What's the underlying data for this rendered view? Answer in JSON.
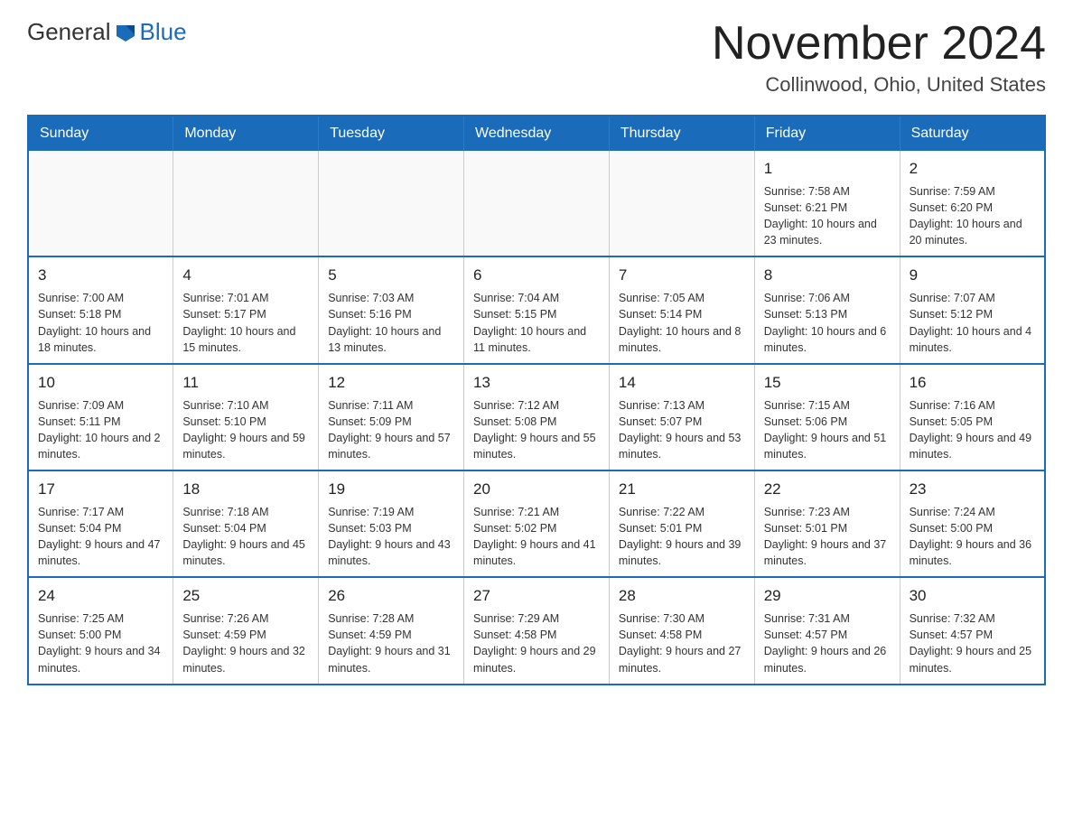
{
  "logo": {
    "general": "General",
    "blue": "Blue"
  },
  "title": "November 2024",
  "subtitle": "Collinwood, Ohio, United States",
  "weekdays": [
    "Sunday",
    "Monday",
    "Tuesday",
    "Wednesday",
    "Thursday",
    "Friday",
    "Saturday"
  ],
  "weeks": [
    [
      {
        "day": "",
        "info": ""
      },
      {
        "day": "",
        "info": ""
      },
      {
        "day": "",
        "info": ""
      },
      {
        "day": "",
        "info": ""
      },
      {
        "day": "",
        "info": ""
      },
      {
        "day": "1",
        "info": "Sunrise: 7:58 AM\nSunset: 6:21 PM\nDaylight: 10 hours and 23 minutes."
      },
      {
        "day": "2",
        "info": "Sunrise: 7:59 AM\nSunset: 6:20 PM\nDaylight: 10 hours and 20 minutes."
      }
    ],
    [
      {
        "day": "3",
        "info": "Sunrise: 7:00 AM\nSunset: 5:18 PM\nDaylight: 10 hours and 18 minutes."
      },
      {
        "day": "4",
        "info": "Sunrise: 7:01 AM\nSunset: 5:17 PM\nDaylight: 10 hours and 15 minutes."
      },
      {
        "day": "5",
        "info": "Sunrise: 7:03 AM\nSunset: 5:16 PM\nDaylight: 10 hours and 13 minutes."
      },
      {
        "day": "6",
        "info": "Sunrise: 7:04 AM\nSunset: 5:15 PM\nDaylight: 10 hours and 11 minutes."
      },
      {
        "day": "7",
        "info": "Sunrise: 7:05 AM\nSunset: 5:14 PM\nDaylight: 10 hours and 8 minutes."
      },
      {
        "day": "8",
        "info": "Sunrise: 7:06 AM\nSunset: 5:13 PM\nDaylight: 10 hours and 6 minutes."
      },
      {
        "day": "9",
        "info": "Sunrise: 7:07 AM\nSunset: 5:12 PM\nDaylight: 10 hours and 4 minutes."
      }
    ],
    [
      {
        "day": "10",
        "info": "Sunrise: 7:09 AM\nSunset: 5:11 PM\nDaylight: 10 hours and 2 minutes."
      },
      {
        "day": "11",
        "info": "Sunrise: 7:10 AM\nSunset: 5:10 PM\nDaylight: 9 hours and 59 minutes."
      },
      {
        "day": "12",
        "info": "Sunrise: 7:11 AM\nSunset: 5:09 PM\nDaylight: 9 hours and 57 minutes."
      },
      {
        "day": "13",
        "info": "Sunrise: 7:12 AM\nSunset: 5:08 PM\nDaylight: 9 hours and 55 minutes."
      },
      {
        "day": "14",
        "info": "Sunrise: 7:13 AM\nSunset: 5:07 PM\nDaylight: 9 hours and 53 minutes."
      },
      {
        "day": "15",
        "info": "Sunrise: 7:15 AM\nSunset: 5:06 PM\nDaylight: 9 hours and 51 minutes."
      },
      {
        "day": "16",
        "info": "Sunrise: 7:16 AM\nSunset: 5:05 PM\nDaylight: 9 hours and 49 minutes."
      }
    ],
    [
      {
        "day": "17",
        "info": "Sunrise: 7:17 AM\nSunset: 5:04 PM\nDaylight: 9 hours and 47 minutes."
      },
      {
        "day": "18",
        "info": "Sunrise: 7:18 AM\nSunset: 5:04 PM\nDaylight: 9 hours and 45 minutes."
      },
      {
        "day": "19",
        "info": "Sunrise: 7:19 AM\nSunset: 5:03 PM\nDaylight: 9 hours and 43 minutes."
      },
      {
        "day": "20",
        "info": "Sunrise: 7:21 AM\nSunset: 5:02 PM\nDaylight: 9 hours and 41 minutes."
      },
      {
        "day": "21",
        "info": "Sunrise: 7:22 AM\nSunset: 5:01 PM\nDaylight: 9 hours and 39 minutes."
      },
      {
        "day": "22",
        "info": "Sunrise: 7:23 AM\nSunset: 5:01 PM\nDaylight: 9 hours and 37 minutes."
      },
      {
        "day": "23",
        "info": "Sunrise: 7:24 AM\nSunset: 5:00 PM\nDaylight: 9 hours and 36 minutes."
      }
    ],
    [
      {
        "day": "24",
        "info": "Sunrise: 7:25 AM\nSunset: 5:00 PM\nDaylight: 9 hours and 34 minutes."
      },
      {
        "day": "25",
        "info": "Sunrise: 7:26 AM\nSunset: 4:59 PM\nDaylight: 9 hours and 32 minutes."
      },
      {
        "day": "26",
        "info": "Sunrise: 7:28 AM\nSunset: 4:59 PM\nDaylight: 9 hours and 31 minutes."
      },
      {
        "day": "27",
        "info": "Sunrise: 7:29 AM\nSunset: 4:58 PM\nDaylight: 9 hours and 29 minutes."
      },
      {
        "day": "28",
        "info": "Sunrise: 7:30 AM\nSunset: 4:58 PM\nDaylight: 9 hours and 27 minutes."
      },
      {
        "day": "29",
        "info": "Sunrise: 7:31 AM\nSunset: 4:57 PM\nDaylight: 9 hours and 26 minutes."
      },
      {
        "day": "30",
        "info": "Sunrise: 7:32 AM\nSunset: 4:57 PM\nDaylight: 9 hours and 25 minutes."
      }
    ]
  ]
}
